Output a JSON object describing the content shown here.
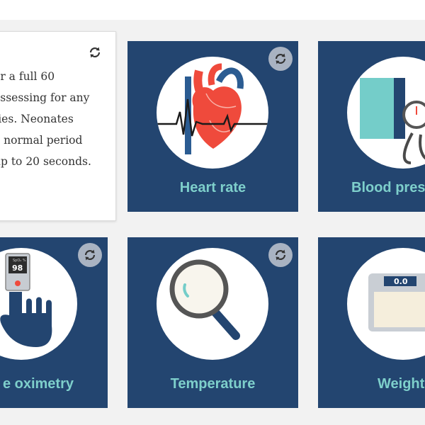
{
  "info_card": {
    "text_lines": [
      "or a full 60",
      "assessing for any",
      "ties. Neonates",
      "a normal period",
      "up to 20 seconds."
    ]
  },
  "cards": [
    {
      "label": "Heart rate",
      "icon": "heart-icon"
    },
    {
      "label": "Blood pres",
      "icon": "blood-pressure-cuff-icon"
    },
    {
      "label": "e oximetry",
      "icon": "pulse-oximeter-icon",
      "display_value": "98",
      "small_text": "SpO₂ %"
    },
    {
      "label": "Temperature",
      "icon": "magnifying-glass-icon"
    },
    {
      "label": "Weight",
      "icon": "scale-icon",
      "display_value": "0.0"
    }
  ],
  "colors": {
    "card_bg": "#234570",
    "label": "#7ecfcb",
    "heart_red": "#ef4a3c",
    "vessel_blue": "#2b5c92",
    "cuff_teal": "#74cdc9"
  }
}
